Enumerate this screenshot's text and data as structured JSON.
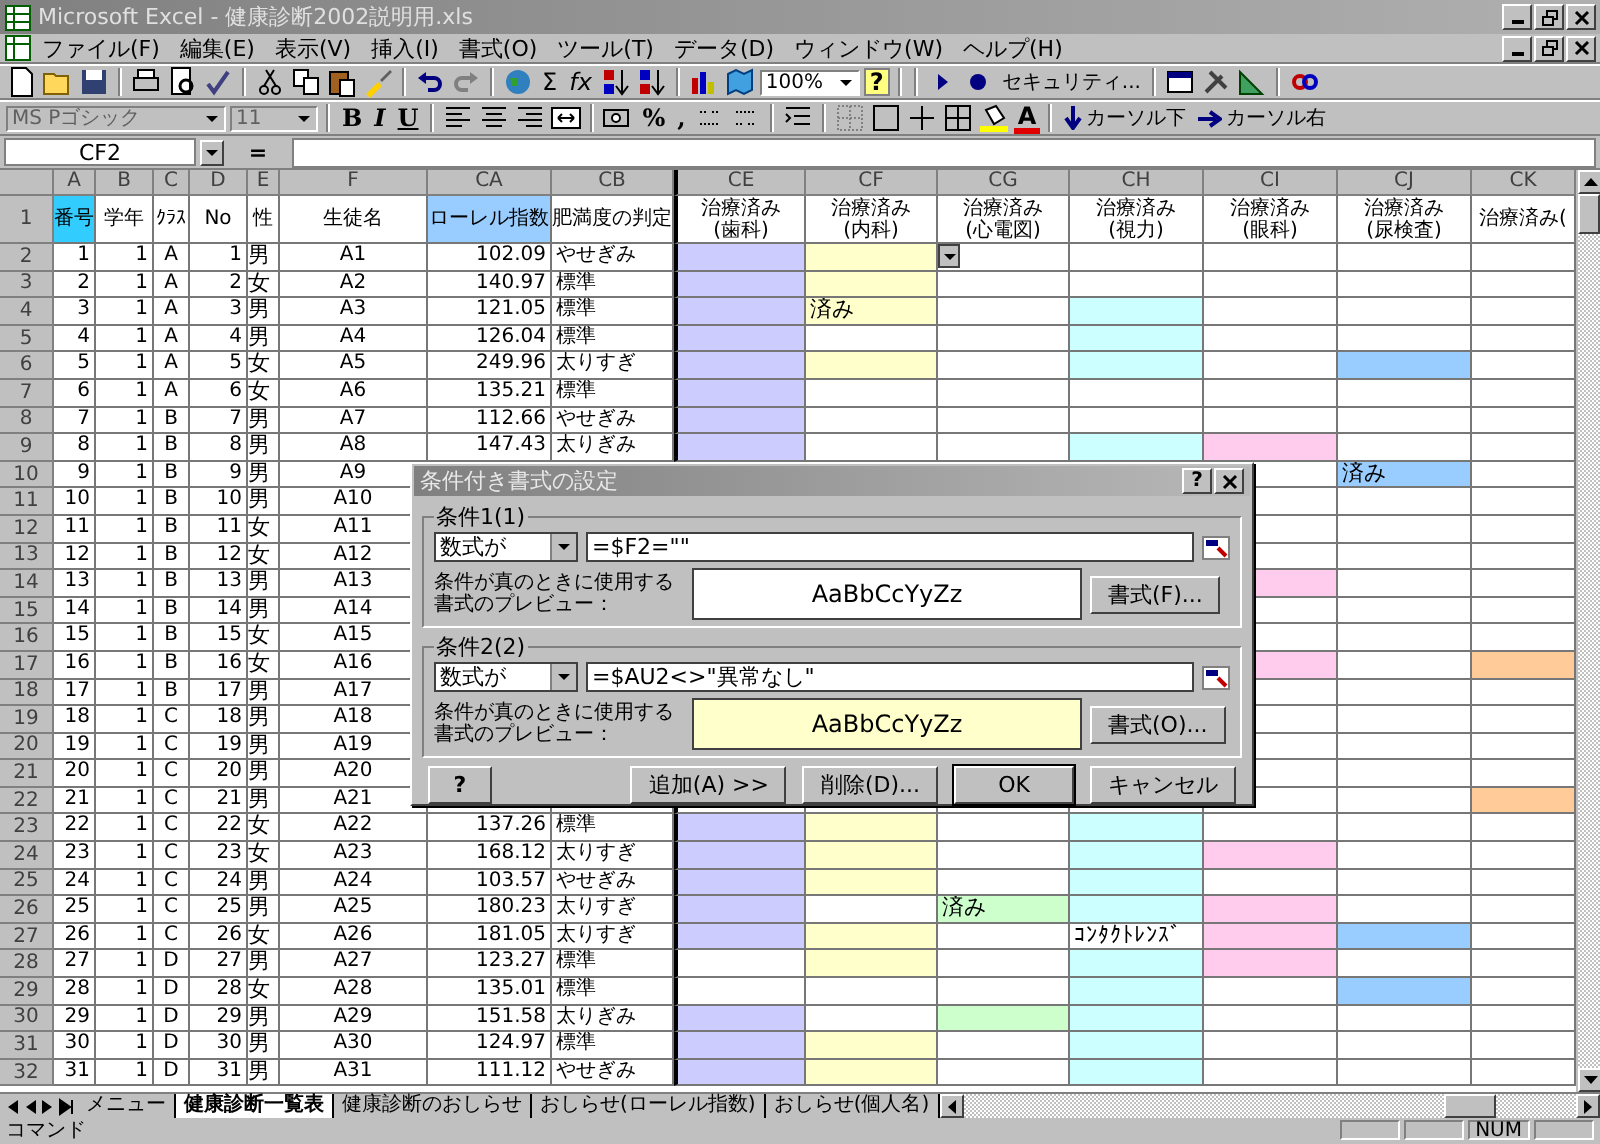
{
  "window": {
    "title": "Microsoft Excel - 健康診断2002説明用.xls"
  },
  "menu": [
    "ファイル(F)",
    "編集(E)",
    "表示(V)",
    "挿入(I)",
    "書式(O)",
    "ツール(T)",
    "データ(D)",
    "ウィンドウ(W)",
    "ヘルプ(H)"
  ],
  "standard_toolbar": {
    "sum": "Σ",
    "function": "fx",
    "zoom": "100%",
    "help": "?",
    "security": "セキュリティ..."
  },
  "formatting_toolbar": {
    "font": "MS Pゴシック",
    "size": "11",
    "bold": "B",
    "italic": "I",
    "underline": "U",
    "percent": "%",
    "comma": ",",
    "font_color": "A",
    "cursor_down": "カーソル下",
    "cursor_right": "カーソル右"
  },
  "formula_bar": {
    "name_box": "CF2",
    "equals": "="
  },
  "header_row_num": "1",
  "columns": [
    {
      "letter": "A",
      "header": "番号",
      "color": "#33ccff"
    },
    {
      "letter": "B",
      "header": "学年",
      "color": "#ffffff"
    },
    {
      "letter": "C",
      "header": "ｸﾗｽ",
      "color": "#ffffff"
    },
    {
      "letter": "D",
      "header": "No",
      "color": "#ffffff"
    },
    {
      "letter": "E",
      "header": "性",
      "color": "#ffffff"
    },
    {
      "letter": "F",
      "header": "生徒名",
      "color": "#ffffff"
    },
    {
      "letter": "CA",
      "header": "ローレル指数",
      "color": "#99ccff"
    },
    {
      "letter": "CB",
      "header": "肥満度の判定",
      "color": "#ffffff"
    },
    {
      "letter": "CE",
      "header": "治療済み(歯科)",
      "color": "#ffffff"
    },
    {
      "letter": "CF",
      "header": "治療済み(内科)",
      "color": "#ffffff"
    },
    {
      "letter": "CG",
      "header": "治療済み(心電図)",
      "color": "#ffffff"
    },
    {
      "letter": "CH",
      "header": "治療済み(視力)",
      "color": "#ffffff"
    },
    {
      "letter": "CI",
      "header": "治療済み(眼科)",
      "color": "#ffffff"
    },
    {
      "letter": "CJ",
      "header": "治療済み(尿検査)",
      "color": "#ffffff"
    },
    {
      "letter": "CK",
      "header": "治療済み(",
      "color": "#ffffff"
    }
  ],
  "rows": [
    {
      "num": "2",
      "cells": [
        "1",
        "1",
        "A",
        "1",
        "男",
        "A1",
        "102.09",
        "やせぎみ"
      ],
      "right": [
        {
          "color": "#ccccff"
        },
        {
          "color": "#ffffcc"
        },
        {
          "color": "#ffffff",
          "dropdown": true
        },
        {
          "color": "#ffffff"
        },
        {
          "color": "#ffffff"
        },
        {
          "color": "#ffffff"
        },
        {
          "color": "#ffffff"
        }
      ]
    },
    {
      "num": "3",
      "cells": [
        "2",
        "1",
        "A",
        "2",
        "女",
        "A2",
        "140.97",
        "標準"
      ],
      "right": [
        {
          "color": "#ccccff"
        },
        {
          "color": "#ffffcc"
        },
        {
          "color": "#ffffff"
        },
        {
          "color": "#ffffff"
        },
        {
          "color": "#ffffff"
        },
        {
          "color": "#ffffff"
        },
        {
          "color": "#ffffff"
        }
      ]
    },
    {
      "num": "4",
      "cells": [
        "3",
        "1",
        "A",
        "3",
        "男",
        "A3",
        "121.05",
        "標準"
      ],
      "right": [
        {
          "color": "#ccccff"
        },
        {
          "color": "#ffffcc",
          "text": "済み"
        },
        {
          "color": "#ffffff"
        },
        {
          "color": "#ccffff"
        },
        {
          "color": "#ffffff"
        },
        {
          "color": "#ffffff"
        },
        {
          "color": "#ffffff"
        }
      ]
    },
    {
      "num": "5",
      "cells": [
        "4",
        "1",
        "A",
        "4",
        "男",
        "A4",
        "126.04",
        "標準"
      ],
      "right": [
        {
          "color": "#ccccff"
        },
        {
          "color": "#ffffff"
        },
        {
          "color": "#ffffff"
        },
        {
          "color": "#ccffff"
        },
        {
          "color": "#ffffff"
        },
        {
          "color": "#ffffff"
        },
        {
          "color": "#ffffff"
        }
      ]
    },
    {
      "num": "6",
      "cells": [
        "5",
        "1",
        "A",
        "5",
        "女",
        "A5",
        "249.96",
        "太りすぎ"
      ],
      "right": [
        {
          "color": "#ccccff"
        },
        {
          "color": "#ffffcc"
        },
        {
          "color": "#ffffff"
        },
        {
          "color": "#ccffff"
        },
        {
          "color": "#ffffff"
        },
        {
          "color": "#99ccff"
        },
        {
          "color": "#ffffff"
        }
      ]
    },
    {
      "num": "7",
      "cells": [
        "6",
        "1",
        "A",
        "6",
        "女",
        "A6",
        "135.21",
        "標準"
      ],
      "right": [
        {
          "color": "#ccccff"
        },
        {
          "color": "#ffffff"
        },
        {
          "color": "#ffffff"
        },
        {
          "color": "#ffffff"
        },
        {
          "color": "#ffffff"
        },
        {
          "color": "#ffffff"
        },
        {
          "color": "#ffffff"
        }
      ]
    },
    {
      "num": "8",
      "cells": [
        "7",
        "1",
        "B",
        "7",
        "男",
        "A7",
        "112.66",
        "やせぎみ"
      ],
      "right": [
        {
          "color": "#ccccff"
        },
        {
          "color": "#ffffff"
        },
        {
          "color": "#ffffff"
        },
        {
          "color": "#ffffff"
        },
        {
          "color": "#ffffff"
        },
        {
          "color": "#ffffff"
        },
        {
          "color": "#ffffff"
        }
      ]
    },
    {
      "num": "9",
      "cells": [
        "8",
        "1",
        "B",
        "8",
        "男",
        "A8",
        "147.43",
        "太りぎみ"
      ],
      "right": [
        {
          "color": "#ccccff"
        },
        {
          "color": "#ffffff"
        },
        {
          "color": "#ffffff"
        },
        {
          "color": "#ccffff"
        },
        {
          "color": "#ffccee"
        },
        {
          "color": "#ffffff"
        },
        {
          "color": "#ffffff"
        }
      ]
    },
    {
      "num": "10",
      "cells": [
        "9",
        "1",
        "B",
        "9",
        "男",
        "A9"
      ],
      "right": [
        {
          "color": "#ffffff"
        },
        {
          "color": "#99ccff",
          "text": "済み"
        },
        {
          "color": "#ffffff"
        }
      ]
    },
    {
      "num": "11",
      "cells": [
        "10",
        "1",
        "B",
        "10",
        "男",
        "A10"
      ],
      "right": [
        {
          "color": "#ffffff"
        },
        {
          "color": "#ffffff"
        },
        {
          "color": "#ffffff"
        }
      ]
    },
    {
      "num": "12",
      "cells": [
        "11",
        "1",
        "B",
        "11",
        "女",
        "A11"
      ],
      "right": [
        {
          "color": "#ffffff"
        },
        {
          "color": "#ffffff"
        },
        {
          "color": "#ffffff"
        }
      ]
    },
    {
      "num": "13",
      "cells": [
        "12",
        "1",
        "B",
        "12",
        "女",
        "A12"
      ],
      "right": [
        {
          "color": "#ffffff"
        },
        {
          "color": "#ffffff"
        },
        {
          "color": "#ffffff"
        }
      ]
    },
    {
      "num": "14",
      "cells": [
        "13",
        "1",
        "B",
        "13",
        "男",
        "A13"
      ],
      "right": [
        {
          "color": "#ffccee"
        },
        {
          "color": "#ffffff"
        },
        {
          "color": "#ffffff"
        }
      ]
    },
    {
      "num": "15",
      "cells": [
        "14",
        "1",
        "B",
        "14",
        "男",
        "A14"
      ],
      "right": [
        {
          "color": "#ffffff"
        },
        {
          "color": "#ffffff"
        },
        {
          "color": "#ffffff"
        }
      ]
    },
    {
      "num": "16",
      "cells": [
        "15",
        "1",
        "B",
        "15",
        "女",
        "A15"
      ],
      "right": [
        {
          "color": "#ffffff"
        },
        {
          "color": "#ffffff"
        },
        {
          "color": "#ffffff"
        }
      ]
    },
    {
      "num": "17",
      "cells": [
        "16",
        "1",
        "B",
        "16",
        "女",
        "A16"
      ],
      "right": [
        {
          "color": "#ffccee"
        },
        {
          "color": "#ffffff"
        },
        {
          "color": "#ffcc99"
        }
      ]
    },
    {
      "num": "18",
      "cells": [
        "17",
        "1",
        "B",
        "17",
        "男",
        "A17"
      ],
      "right": [
        {
          "color": "#ffffff"
        },
        {
          "color": "#ffffff"
        },
        {
          "color": "#ffffff"
        }
      ]
    },
    {
      "num": "19",
      "cells": [
        "18",
        "1",
        "C",
        "18",
        "男",
        "A18"
      ],
      "right": [
        {
          "color": "#ffffff"
        },
        {
          "color": "#ffffff"
        },
        {
          "color": "#ffffff"
        }
      ]
    },
    {
      "num": "20",
      "cells": [
        "19",
        "1",
        "C",
        "19",
        "男",
        "A19"
      ],
      "right": [
        {
          "color": "#ffffff"
        },
        {
          "color": "#ffffff"
        },
        {
          "color": "#ffffff"
        }
      ]
    },
    {
      "num": "21",
      "cells": [
        "20",
        "1",
        "C",
        "20",
        "男",
        "A20"
      ],
      "right": [
        {
          "color": "#ffffff"
        },
        {
          "color": "#ffffff"
        },
        {
          "color": "#ffffff"
        }
      ]
    },
    {
      "num": "22",
      "cells": [
        "21",
        "1",
        "C",
        "21",
        "男",
        "A21"
      ],
      "right": [
        {
          "color": "#ffffff"
        },
        {
          "color": "#ffffff"
        },
        {
          "color": "#ffcc99"
        }
      ]
    },
    {
      "num": "23",
      "cells": [
        "22",
        "1",
        "C",
        "22",
        "女",
        "A22",
        "137.26",
        "標準"
      ],
      "right": [
        {
          "color": "#ccccff"
        },
        {
          "color": "#ffffcc"
        },
        {
          "color": "#ffffff"
        },
        {
          "color": "#ccffff"
        },
        {
          "color": "#ffffff"
        },
        {
          "color": "#ffffff"
        },
        {
          "color": "#ffffff"
        }
      ]
    },
    {
      "num": "24",
      "cells": [
        "23",
        "1",
        "C",
        "23",
        "女",
        "A23",
        "168.12",
        "太りすぎ"
      ],
      "right": [
        {
          "color": "#ccccff"
        },
        {
          "color": "#ffffcc"
        },
        {
          "color": "#ffffff"
        },
        {
          "color": "#ccffff"
        },
        {
          "color": "#ffccee"
        },
        {
          "color": "#ffffff"
        },
        {
          "color": "#ffffff"
        }
      ]
    },
    {
      "num": "25",
      "cells": [
        "24",
        "1",
        "C",
        "24",
        "男",
        "A24",
        "103.57",
        "やせぎみ"
      ],
      "right": [
        {
          "color": "#ccccff"
        },
        {
          "color": "#ffffcc"
        },
        {
          "color": "#ffffff"
        },
        {
          "color": "#ccffff"
        },
        {
          "color": "#ffffff"
        },
        {
          "color": "#ffffff"
        },
        {
          "color": "#ffffff"
        }
      ]
    },
    {
      "num": "26",
      "cells": [
        "25",
        "1",
        "C",
        "25",
        "男",
        "A25",
        "180.23",
        "太りすぎ"
      ],
      "right": [
        {
          "color": "#ccccff"
        },
        {
          "color": "#ffffff"
        },
        {
          "color": "#ccffcc",
          "text": "済み"
        },
        {
          "color": "#ccffff"
        },
        {
          "color": "#ffccee"
        },
        {
          "color": "#ffffff"
        },
        {
          "color": "#ffffff"
        }
      ]
    },
    {
      "num": "27",
      "cells": [
        "26",
        "1",
        "C",
        "26",
        "女",
        "A26",
        "181.05",
        "太りすぎ"
      ],
      "right": [
        {
          "color": "#ccccff"
        },
        {
          "color": "#ffffcc"
        },
        {
          "color": "#ffffff"
        },
        {
          "color": "#ffffff",
          "text": "ｺﾝﾀｸﾄﾚﾝｽﾞ"
        },
        {
          "color": "#ffccee"
        },
        {
          "color": "#99ccff"
        },
        {
          "color": "#ffffff"
        }
      ]
    },
    {
      "num": "28",
      "cells": [
        "27",
        "1",
        "D",
        "27",
        "男",
        "A27",
        "123.27",
        "標準"
      ],
      "right": [
        {
          "color": "#ffffff"
        },
        {
          "color": "#ffffcc"
        },
        {
          "color": "#ffffff"
        },
        {
          "color": "#ccffff"
        },
        {
          "color": "#ffccee"
        },
        {
          "color": "#ffffff"
        },
        {
          "color": "#ffffff"
        }
      ]
    },
    {
      "num": "29",
      "cells": [
        "28",
        "1",
        "D",
        "28",
        "女",
        "A28",
        "135.01",
        "標準"
      ],
      "right": [
        {
          "color": "#ffffff"
        },
        {
          "color": "#ffffff"
        },
        {
          "color": "#ffffff"
        },
        {
          "color": "#ccffff"
        },
        {
          "color": "#ffffff"
        },
        {
          "color": "#99ccff"
        },
        {
          "color": "#ffffff"
        }
      ]
    },
    {
      "num": "30",
      "cells": [
        "29",
        "1",
        "D",
        "29",
        "男",
        "A29",
        "151.58",
        "太りぎみ"
      ],
      "right": [
        {
          "color": "#ccccff"
        },
        {
          "color": "#ffffff"
        },
        {
          "color": "#ccffcc"
        },
        {
          "color": "#ccffff"
        },
        {
          "color": "#ffffff"
        },
        {
          "color": "#ffffff"
        },
        {
          "color": "#ffffff"
        }
      ]
    },
    {
      "num": "31",
      "cells": [
        "30",
        "1",
        "D",
        "30",
        "男",
        "A30",
        "124.97",
        "標準"
      ],
      "right": [
        {
          "color": "#ccccff"
        },
        {
          "color": "#ffffcc"
        },
        {
          "color": "#ffffff"
        },
        {
          "color": "#ccffff"
        },
        {
          "color": "#ffffff"
        },
        {
          "color": "#ffffff"
        },
        {
          "color": "#ffffff"
        }
      ]
    },
    {
      "num": "32",
      "cells": [
        "31",
        "1",
        "D",
        "31",
        "男",
        "A31",
        "111.12",
        "やせぎみ"
      ],
      "right": [
        {
          "color": "#ccccff"
        },
        {
          "color": "#ffffcc"
        },
        {
          "color": "#ffffff"
        },
        {
          "color": "#ccffff"
        },
        {
          "color": "#ffffff"
        },
        {
          "color": "#ffffff"
        },
        {
          "color": "#ffffff"
        }
      ]
    }
  ],
  "dialog": {
    "title": "条件付き書式の設定",
    "title_help": "?",
    "conditions": [
      {
        "label": "条件1(1)",
        "type": "数式が",
        "formula": "=$F2=\"\"",
        "preview_label": "条件が真のときに使用する書式のプレビュー：",
        "preview": "AaBbCcYyZz",
        "color": "#ffffff",
        "format_button": "書式(F)..."
      },
      {
        "label": "条件2(2)",
        "type": "数式が",
        "formula": "=$AU2<>\"異常なし\"",
        "preview_label": "条件が真のときに使用する書式のプレビュー：",
        "preview": "AaBbCcYyZz",
        "color": "#ffffcc",
        "format_button": "書式(O)..."
      }
    ],
    "help": "?",
    "buttons": [
      "追加(A) >>",
      "削除(D)...",
      "OK",
      "キャンセル"
    ]
  },
  "sheet_tabs": [
    {
      "label": "メニュー",
      "selected": false
    },
    {
      "label": "健康診断一覧表",
      "selected": true
    },
    {
      "label": "健康診断のおしらせ",
      "selected": false
    },
    {
      "label": "おしらせ(ローレル指数)",
      "selected": false
    },
    {
      "label": "おしらせ(個人名)",
      "selected": false
    }
  ],
  "status_bar": {
    "mode": "コマンド",
    "num": "NUM"
  }
}
